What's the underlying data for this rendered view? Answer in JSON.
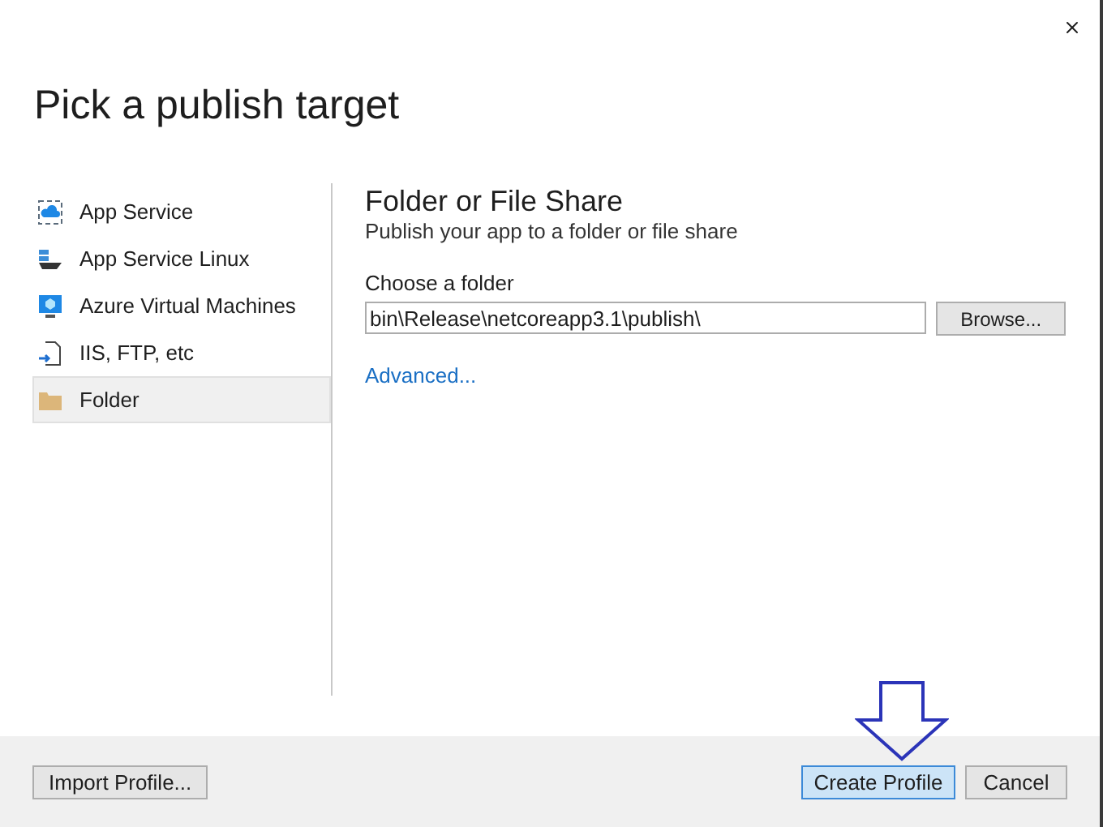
{
  "title": "Pick a publish target",
  "targets": [
    {
      "label": "App Service",
      "selected": false
    },
    {
      "label": "App Service Linux",
      "selected": false
    },
    {
      "label": "Azure Virtual Machines",
      "selected": false
    },
    {
      "label": "IIS, FTP, etc",
      "selected": false
    },
    {
      "label": "Folder",
      "selected": true
    }
  ],
  "detail": {
    "heading": "Folder or File Share",
    "description": "Publish your app to a folder or file share",
    "field_label": "Choose a folder",
    "field_value": "bin\\Release\\netcoreapp3.1\\publish\\",
    "browse": "Browse...",
    "advanced": "Advanced..."
  },
  "footer": {
    "import": "Import Profile...",
    "create": "Create Profile",
    "cancel": "Cancel"
  }
}
